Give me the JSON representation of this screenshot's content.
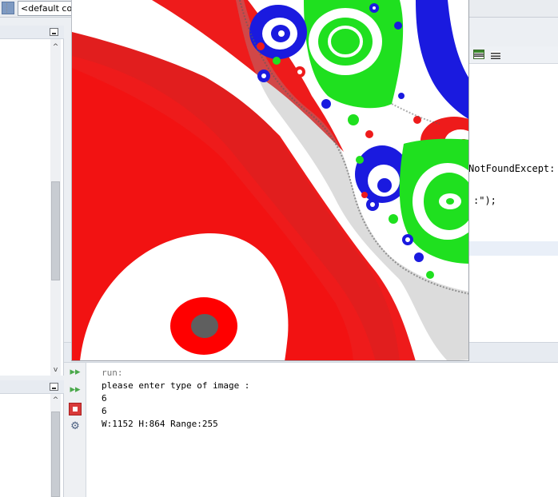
{
  "toolbar": {
    "config_combo": "<default conf"
  },
  "editor": {
    "lines": [
      {
        "text": "NotFoundExcept:"
      },
      {
        "text": ":\");"
      }
    ]
  },
  "output": {
    "lines": [
      {
        "text": "run:",
        "style": "dim"
      },
      {
        "text": "please enter type of image :",
        "style": "normal"
      },
      {
        "text": "6",
        "style": "normal"
      },
      {
        "text": "6",
        "style": "normal"
      },
      {
        "text": "W:1152 H:864 Range:255",
        "style": "normal"
      }
    ]
  },
  "icons": {
    "rerun": "rerun-icon",
    "rerun_alt": "rerun-with-input-icon",
    "stop": "stop-icon",
    "settings": "settings-icon"
  },
  "colors": {
    "fractal_red": "#ee1b1b",
    "fractal_green": "#1fe01f",
    "fractal_blue": "#1a1adf",
    "fractal_core": "#5f5f5f",
    "fractal_white": "#ffffff"
  }
}
